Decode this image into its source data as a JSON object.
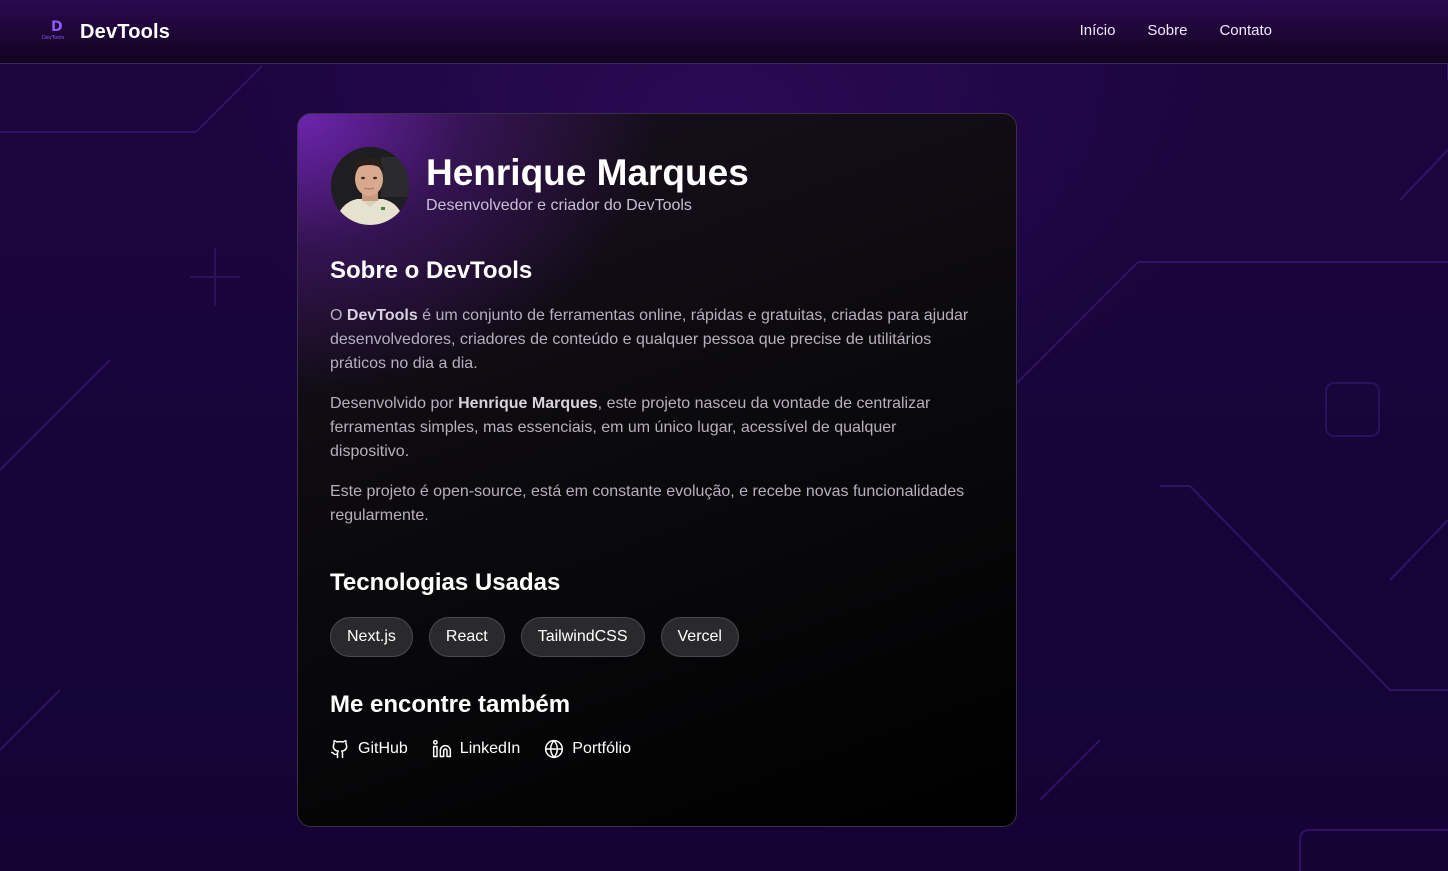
{
  "header": {
    "logo_mark": "D",
    "logo_mark_sub": "DevTools",
    "logo_text": "DevTools",
    "nav": [
      {
        "label": "Início"
      },
      {
        "label": "Sobre"
      },
      {
        "label": "Contato"
      }
    ]
  },
  "profile": {
    "name": "Henrique Marques",
    "role": "Desenvolvedor e criador do DevTools"
  },
  "about": {
    "title": "Sobre o DevTools",
    "p1_start": "O ",
    "p1_bold": "DevTools",
    "p1_rest": " é um conjunto de ferramentas online, rápidas e gratuitas, criadas para ajudar desenvolvedores, criadores de conteúdo e qualquer pessoa que precise de utilitários práticos no dia a dia.",
    "p2_start": "Desenvolvido por ",
    "p2_bold": "Henrique Marques",
    "p2_rest": ", este projeto nasceu da vontade de centralizar ferramentas simples, mas essenciais, em um único lugar, acessível de qualquer dispositivo.",
    "p3": "Este projeto é open-source, está em constante evolução, e recebe novas funcionalidades regularmente."
  },
  "tech": {
    "title": "Tecnologias Usadas",
    "items": [
      "Next.js",
      "React",
      "TailwindCSS",
      "Vercel"
    ]
  },
  "social": {
    "title": "Me encontre também",
    "links": [
      {
        "label": "GitHub",
        "icon": "github-icon"
      },
      {
        "label": "LinkedIn",
        "icon": "linkedin-icon"
      },
      {
        "label": "Portfólio",
        "icon": "globe-icon"
      }
    ]
  },
  "colors": {
    "accent": "#8b5cf6",
    "card_glow": "#7c28c8",
    "chip_bg": "#2a2a2c"
  }
}
